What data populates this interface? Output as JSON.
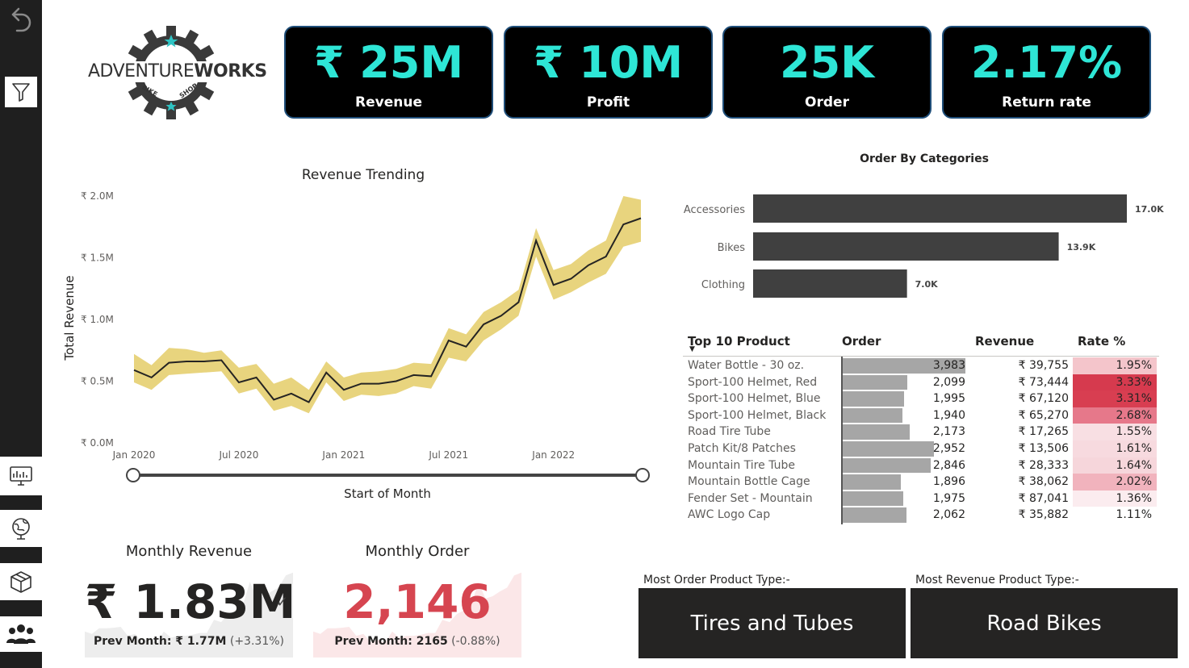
{
  "nav": {
    "icons": [
      "back-arrow-icon",
      "filter-icon",
      "dashboard-monitor-icon",
      "globe-icon",
      "box-icon",
      "people-icon"
    ]
  },
  "logo": {
    "text_a": "ADVENTURE",
    "text_b": "WORKS",
    "sub_left": "BIKE",
    "sub_right": "SHOP"
  },
  "kpis": [
    {
      "value": "₹ 25M",
      "label": "Revenue"
    },
    {
      "value": "₹ 10M",
      "label": "Profit"
    },
    {
      "value": "25K",
      "label": "Order"
    },
    {
      "value": "2.17%",
      "label": "Return rate"
    }
  ],
  "chart_data": [
    {
      "type": "line",
      "title": "Revenue Trending",
      "xlabel": "Start of Month",
      "ylabel": "Total Revenue",
      "y_ticks": [
        "₹ 0.0M",
        "₹ 0.5M",
        "₹ 1.0M",
        "₹ 1.5M",
        "₹ 2.0M"
      ],
      "x_ticks": [
        "Jan 2020",
        "Jul 2020",
        "Jan 2021",
        "Jul 2021",
        "Jan 2022"
      ],
      "ylim": [
        0,
        2.0
      ],
      "x": [
        "Jan 2020",
        "Feb 2020",
        "Mar 2020",
        "Apr 2020",
        "May 2020",
        "Jun 2020",
        "Jul 2020",
        "Aug 2020",
        "Sep 2020",
        "Oct 2020",
        "Nov 2020",
        "Dec 2020",
        "Jan 2021",
        "Feb 2021",
        "Mar 2021",
        "Apr 2021",
        "May 2021",
        "Jun 2021",
        "Jul 2021",
        "Aug 2021",
        "Sep 2021",
        "Oct 2021",
        "Nov 2021",
        "Dec 2021",
        "Jan 2022",
        "Feb 2022",
        "Mar 2022",
        "Apr 2022",
        "May 2022",
        "Jun 2022"
      ],
      "series": [
        {
          "values": [
            0.59,
            0.53,
            0.65,
            0.66,
            0.66,
            0.67,
            0.49,
            0.53,
            0.35,
            0.4,
            0.33,
            0.57,
            0.43,
            0.48,
            0.48,
            0.5,
            0.55,
            0.54,
            0.83,
            0.78,
            0.96,
            1.03,
            1.14,
            1.64,
            1.28,
            1.33,
            1.44,
            1.51,
            1.77,
            1.82
          ]
        }
      ],
      "band": {
        "upper": [
          0.72,
          0.63,
          0.77,
          0.76,
          0.73,
          0.75,
          0.61,
          0.64,
          0.48,
          0.53,
          0.43,
          0.66,
          0.53,
          0.57,
          0.58,
          0.6,
          0.65,
          0.64,
          0.93,
          0.88,
          1.06,
          1.14,
          1.24,
          1.74,
          1.4,
          1.45,
          1.56,
          1.64,
          2.0,
          1.97
        ],
        "lower": [
          0.49,
          0.43,
          0.55,
          0.56,
          0.57,
          0.58,
          0.4,
          0.44,
          0.26,
          0.3,
          0.24,
          0.49,
          0.34,
          0.39,
          0.38,
          0.4,
          0.46,
          0.44,
          0.69,
          0.66,
          0.83,
          0.92,
          1.03,
          1.51,
          1.16,
          1.22,
          1.3,
          1.37,
          1.59,
          1.63
        ]
      },
      "colors": {
        "line": "#252423",
        "band": "#e8d47e"
      },
      "slider": {
        "present": true
      }
    },
    {
      "type": "bar",
      "orientation": "horizontal",
      "title": "Order By Categories",
      "categories": [
        "Accessories",
        "Bikes",
        "Clothing"
      ],
      "values": [
        17.0,
        13.9,
        7.0
      ],
      "data_labels": [
        "17.0K",
        "13.9K",
        "7.0K"
      ],
      "xlim": [
        0,
        17.0
      ],
      "colors": {
        "bar": "#404040"
      }
    }
  ],
  "table": {
    "headers": [
      "Top 10 Product",
      "Order",
      "Revenue",
      "Rate %"
    ],
    "sort_indicator": "▼",
    "max_order": 3983,
    "rows": [
      {
        "product": "Water Bottle - 30 oz.",
        "order": 3983,
        "order_text": "3,983",
        "revenue": "₹ 39,755",
        "rate": "1.95%",
        "rate_color": "#f4c5cb"
      },
      {
        "product": "Sport-100 Helmet, Red",
        "order": 2099,
        "order_text": "2,099",
        "revenue": "₹ 73,444",
        "rate": "3.33%",
        "rate_color": "#d63a4e"
      },
      {
        "product": "Sport-100 Helmet, Blue",
        "order": 1995,
        "order_text": "1,995",
        "revenue": "₹ 67,120",
        "rate": "3.31%",
        "rate_color": "#d83e51"
      },
      {
        "product": "Sport-100 Helmet, Black",
        "order": 1940,
        "order_text": "1,940",
        "revenue": "₹ 65,270",
        "rate": "2.68%",
        "rate_color": "#e6788a"
      },
      {
        "product": "Road Tire Tube",
        "order": 2173,
        "order_text": "2,173",
        "revenue": "₹ 17,265",
        "rate": "1.55%",
        "rate_color": "#f8dfe3"
      },
      {
        "product": "Patch Kit/8 Patches",
        "order": 2952,
        "order_text": "2,952",
        "revenue": "₹ 13,506",
        "rate": "1.61%",
        "rate_color": "#f7dadf"
      },
      {
        "product": "Mountain Tire Tube",
        "order": 2846,
        "order_text": "2,846",
        "revenue": "₹ 28,333",
        "rate": "1.64%",
        "rate_color": "#f6d6db"
      },
      {
        "product": "Mountain Bottle Cage",
        "order": 1896,
        "order_text": "1,896",
        "revenue": "₹ 38,062",
        "rate": "2.02%",
        "rate_color": "#f1b3bd"
      },
      {
        "product": "Fender Set - Mountain",
        "order": 1975,
        "order_text": "1,975",
        "revenue": "₹ 87,041",
        "rate": "1.36%",
        "rate_color": "#fbecef"
      },
      {
        "product": "AWC Logo Cap",
        "order": 2062,
        "order_text": "2,062",
        "revenue": "₹ 35,882",
        "rate": "1.11%",
        "rate_color": "#ffffff"
      }
    ]
  },
  "monthly_revenue": {
    "title": "Monthly Revenue",
    "value": "₹ 1.83M",
    "status": "✓",
    "prev_label": "Prev Month: ₹ 1.77M",
    "prev_change": " (+3.31%)",
    "color": "#252423",
    "spark": [
      0.55,
      0.5,
      0.62,
      0.62,
      0.63,
      0.65,
      0.46,
      0.5,
      0.33,
      0.38,
      0.31,
      0.55,
      0.42,
      0.46,
      0.46,
      0.48,
      0.52,
      0.52,
      0.8,
      0.75,
      0.92,
      1.0,
      1.1,
      1.6,
      1.25,
      1.3,
      1.4,
      1.48,
      1.74,
      1.8
    ]
  },
  "monthly_order": {
    "title": "Monthly Order",
    "value": "2,146",
    "status": "!",
    "prev_label": "Prev Month: 2165",
    "prev_change": " (-0.88%)",
    "color": "#d64550",
    "spark": [
      0.55,
      0.5,
      0.62,
      0.62,
      0.63,
      0.65,
      0.46,
      0.5,
      0.33,
      0.38,
      0.31,
      0.55,
      0.42,
      0.46,
      0.46,
      0.48,
      0.52,
      0.52,
      0.8,
      0.75,
      0.92,
      1.0,
      1.1,
      1.6,
      1.25,
      1.3,
      1.4,
      1.48,
      1.74,
      1.8
    ]
  },
  "product_types": [
    {
      "label": "Most Order Product Type:-",
      "value": "Tires and Tubes"
    },
    {
      "label": "Most Revenue Product Type:-",
      "value": "Road Bikes"
    }
  ]
}
